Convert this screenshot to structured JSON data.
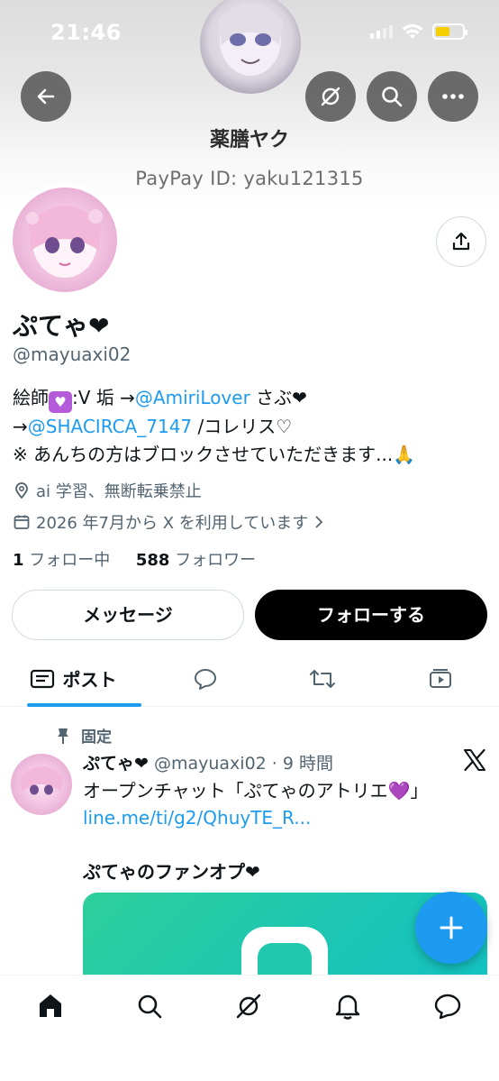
{
  "status_bar": {
    "time": "21:46"
  },
  "banner": {
    "name": "薬膳ヤク",
    "paypay": "PayPay ID: yaku121315"
  },
  "profile": {
    "display_name": "ぷてゃ❤",
    "handle": "@mayuaxi02",
    "bio": {
      "line1_prefix": "絵師",
      "line1_mid": ":V 垢 →",
      "line1_link": "@AmiriLover",
      "line1_suffix": " さぶ❤",
      "line2_prefix": "→",
      "line2_link": "@SHACIRCA_7147",
      "line2_suffix": " /コレリス♡",
      "line3": "※ あんちの方はブロックさせていただきます...🙏"
    },
    "location": "ai 学習、無断転乗禁止",
    "joined": "2026 年7月から X を利用しています",
    "following_count": "1",
    "following_label": "フォロー中",
    "followers_count": "588",
    "followers_label": "フォロワー"
  },
  "actions": {
    "message_label": "メッセージ",
    "follow_label": "フォローする"
  },
  "tabs": [
    {
      "label": "ポスト",
      "icon": "posts-icon",
      "active": true
    },
    {
      "label": "",
      "icon": "reply-icon"
    },
    {
      "label": "",
      "icon": "repost-icon"
    },
    {
      "label": "",
      "icon": "media-icon"
    }
  ],
  "pinned_post": {
    "pinned_label": "固定",
    "name": "ぷてゃ❤",
    "meta": " @mayuaxi02 · 9 時間",
    "text_line1": "オープンチャット「ぷてゃのアトリエ💜」",
    "link": "line.me/ti/g2/QhuyTE_R...",
    "text_line2": "ぷてゃのファンオプ❤"
  },
  "colors": {
    "accent": "#1d9bf0",
    "text": "#0f1419",
    "secondary": "#536471",
    "follow_button": "#000000",
    "media_green": "#20c9ad"
  },
  "bottom_nav": [
    "home-icon",
    "search-icon",
    "grok-icon",
    "notifications-icon",
    "messages-icon"
  ]
}
